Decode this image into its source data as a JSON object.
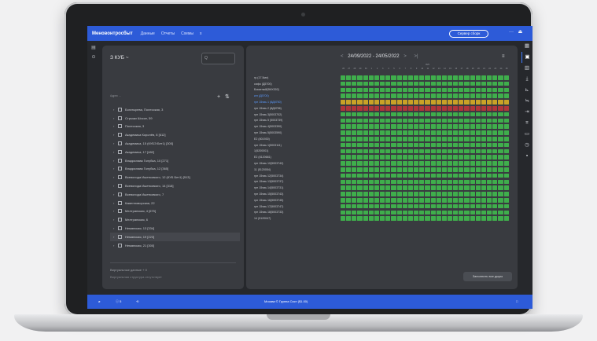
{
  "header": {
    "brand": "Меновонтросбыт",
    "nav": [
      "Данные",
      "Отчеты",
      "Схемы",
      "x"
    ],
    "server_button": "Сервер сборк",
    "right_icons": [
      "menu-icon",
      "user-icon"
    ]
  },
  "left_rail": {
    "icons": [
      "layers-icon",
      "settings-icon"
    ]
  },
  "right_rail": {
    "icons": [
      "grid-icon",
      "calendar-icon",
      "table-icon",
      "download-icon",
      "filter-icon",
      "sort-icon",
      "merge-icon",
      "split-icon",
      "chat-icon",
      "clock-icon",
      "save-icon"
    ],
    "active_index": 1
  },
  "tree_panel": {
    "title": "З КУБ ~",
    "search_placeholder": "Q",
    "tree_label": "Адрес ...",
    "add_button": "+",
    "sort_button": "⇅",
    "items": [
      "Богатырева, Полесская, 3",
      "Стрыжи Шоссе, 59",
      "Полесская, 3",
      "Академика Королёв, 8 [612]",
      "Академика, 15 (КУБЭ Бет1) [300]",
      "Академика, 17 [482]",
      "Владислава Голубка, 10 [271]",
      "Владислава Голубка, 12 [365]",
      "Всеволода Ишетковскго, 12 (КУБ Бет1) [513]",
      "Всеволода Ишетковскго, 14 [318]",
      "Всеволода Ишетковскго, 7",
      "Каменноворская, 22",
      "Мелтранская, 4 [675]",
      "Мелтранская, 6",
      "Неманская, 13 [334]",
      "Неманская, 19 [223]",
      "Неманская, 21 [300]"
    ],
    "selected_index": 15,
    "footer_label": "Виртуальные данные + 0",
    "footer_empty": "Виртуальная структура отсутствует"
  },
  "schedule": {
    "date_range": "24/09/2022 - 24/05/2022",
    "prev": "<",
    "next": ">",
    "next_end": ">|",
    "month_label": "05/5",
    "days": [
      "26",
      "27",
      "28",
      "29",
      "30",
      "1",
      "2",
      "3",
      "4",
      "5",
      "6",
      "7",
      "8",
      "9",
      "10",
      "11",
      "12",
      "13",
      "14",
      "15",
      "16",
      "17",
      "18",
      "19",
      "20",
      "21",
      "22",
      "23",
      "24",
      "25"
    ],
    "rows": [
      {
        "label": "гр.(17.5мл)",
        "status": "ok"
      },
      {
        "label": "сифо (Д5700)",
        "status": "ok"
      },
      {
        "label": "Бокатный(5МХ302)",
        "status": "ok"
      },
      {
        "label": "кгл (Д5700)",
        "status": "ok",
        "highlight": true
      },
      {
        "label": "грн 15чвь 1 (8Д8750)",
        "status": "warning",
        "highlight": true
      },
      {
        "label": "грн 15чвь 2 (8Д8756)",
        "status": "error"
      },
      {
        "label": "грн 15чвь 3(5003702)",
        "status": "ok"
      },
      {
        "label": "грн 15чвь 5 (5003739)",
        "status": "ok"
      },
      {
        "label": "грн 15чвь 4(5003390)",
        "status": "ok"
      },
      {
        "label": "грн 15чвь 5(5003590)",
        "status": "ok"
      },
      {
        "label": "Е2 (801930)",
        "status": "ok"
      },
      {
        "label": "грн 15чвь 1(5003111)",
        "status": "ok"
      },
      {
        "label": "1(5200001)",
        "status": "ok"
      },
      {
        "label": "Е2 (8120681)",
        "status": "ok"
      },
      {
        "label": "грн 15чвь 10(5003742)",
        "status": "ok"
      },
      {
        "label": "11 (5120054)",
        "status": "ok"
      },
      {
        "label": "грн 15чвь 12(5003734)",
        "status": "ok"
      },
      {
        "label": "грн 15чвь 13(5003737)",
        "status": "ok"
      },
      {
        "label": "грн 15чвь 14(5003731)",
        "status": "ok"
      },
      {
        "label": "грн 15чвь 15(5003743)",
        "status": "ok"
      },
      {
        "label": "грн 15чвь 16(5003745)",
        "status": "ok"
      },
      {
        "label": "грн 15чвь 17(5003747)",
        "status": "ok"
      },
      {
        "label": "грн 15чвь 18(5003733)",
        "status": "ok"
      },
      {
        "label": "14 (5120047)",
        "status": "ok"
      }
    ],
    "colors": {
      "ok": "#3fae4c",
      "warning": "#c9a227",
      "error": "#b0353a"
    },
    "fill_button": "Заполнить все дыры"
  },
  "footer": {
    "items": [
      "ø",
      "ⓘ 5",
      "⟲"
    ],
    "center": "Москва © Группа Сист ($1.00)",
    "right": "□"
  }
}
